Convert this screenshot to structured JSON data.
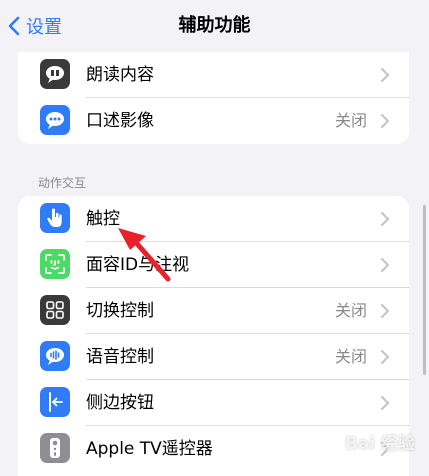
{
  "nav": {
    "back_label": "设置",
    "title": "辅助功能"
  },
  "top_group": [
    {
      "label": "朗读内容",
      "value": "",
      "icon": "speech-bubble-icon",
      "icon_bg": "#3a3a3c"
    },
    {
      "label": "口述影像",
      "value": "关闭",
      "icon": "message-bubble-icon",
      "icon_bg": "#2f7cf6"
    }
  ],
  "section": {
    "header": "动作交互"
  },
  "bottom_group": [
    {
      "label": "触控",
      "value": "",
      "icon": "hand-touch-icon",
      "icon_bg": "#2f7cf6"
    },
    {
      "label": "面容ID与注视",
      "value": "",
      "icon": "face-id-icon",
      "icon_bg": "#4cd964"
    },
    {
      "label": "切换控制",
      "value": "关闭",
      "icon": "switch-grid-icon",
      "icon_bg": "#3a3a3c"
    },
    {
      "label": "语音控制",
      "value": "关闭",
      "icon": "voice-control-icon",
      "icon_bg": "#2f7cf6"
    },
    {
      "label": "侧边按钮",
      "value": "",
      "icon": "side-button-icon",
      "icon_bg": "#2f7cf6"
    },
    {
      "label": "Apple TV遥控器",
      "value": "",
      "icon": "remote-icon",
      "icon_bg": "#8e8e93"
    }
  ],
  "watermark": "Bai 经验",
  "colors": {
    "accent": "#2f7cf6",
    "background": "#f2f2f7",
    "annotation_arrow": "#e8212b"
  }
}
